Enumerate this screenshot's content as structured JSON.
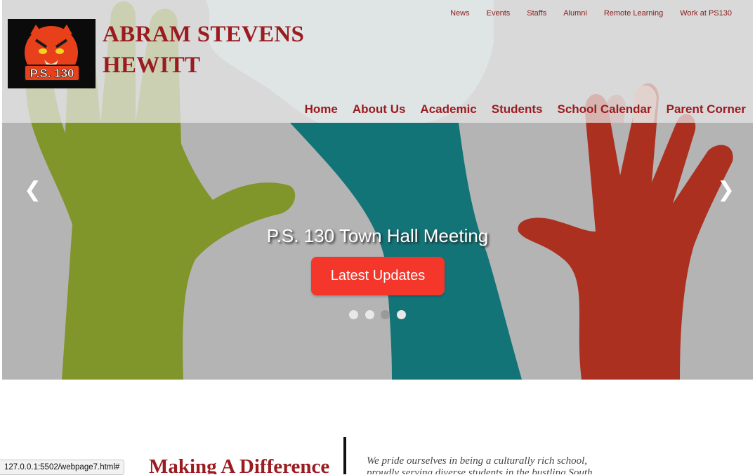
{
  "header": {
    "brand_line1": "ABRAM STEVENS",
    "brand_line2": "HEWITT",
    "logo_text": "P.S. 130"
  },
  "top_nav": [
    "News",
    "Events",
    "Staffs",
    "Alumni",
    "Remote Learning",
    "Work at PS130"
  ],
  "main_nav": [
    "Home",
    "About Us",
    "Academic",
    "Students",
    "School Calendar",
    "Parent Corner"
  ],
  "hero": {
    "title": "P.S. 130 Town Hall Meeting",
    "button_label": "Latest Updates",
    "prev_arrow": "❮",
    "next_arrow": "❯",
    "slide_count": 4,
    "active_slide": 3
  },
  "section": {
    "heading": "Making A Difference",
    "quote_line1": "We pride ourselves in being a culturally rich school,",
    "quote_line2": "proudly serving diverse students in the bustling South"
  },
  "status_bar": {
    "url": "127.0.0.1:5502/webpage7.html#"
  },
  "colors": {
    "brand": "#9b1c20",
    "button": "#f4362b",
    "hand_green": "#80952a",
    "hand_teal": "#137478",
    "hand_red": "#ac3020",
    "hand_lightblue": "#c8dadd",
    "hero_bg": "#b4b4b4"
  }
}
